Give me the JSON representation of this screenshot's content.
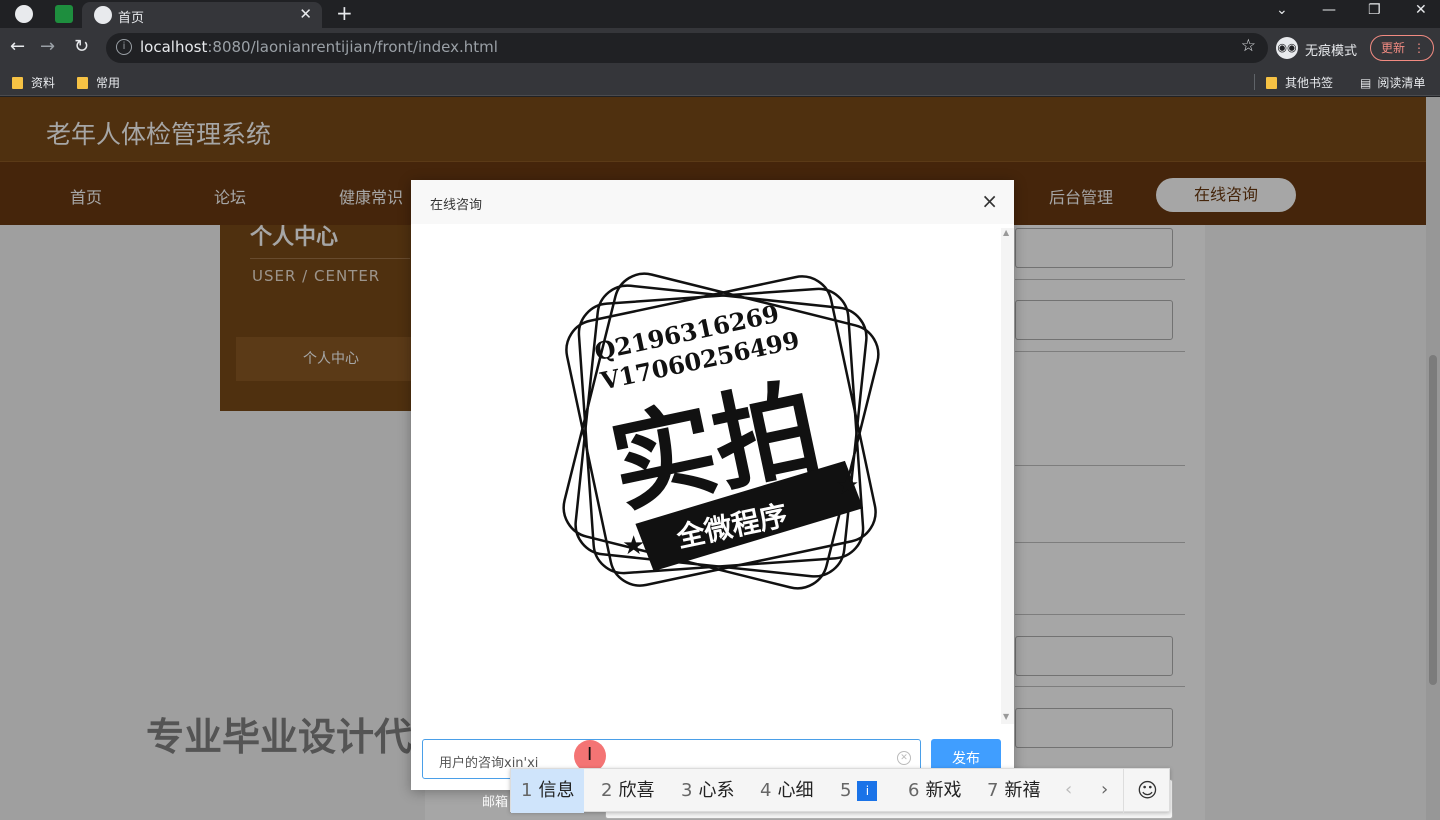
{
  "browser": {
    "tab_title": "首页",
    "url_host": "localhost",
    "url_rest": ":8080/laonianrentijian/front/index.html",
    "incognito_label": "无痕模式",
    "update_label": "更新",
    "bookmarks": [
      "资料",
      "常用"
    ],
    "bookmarks_right": [
      "其他书签",
      "阅读清单"
    ]
  },
  "site": {
    "title": "老年人体检管理系统",
    "nav": [
      "首页",
      "论坛",
      "健康常识",
      "后台管理"
    ],
    "nav_active": "在线咨询"
  },
  "sidebar": {
    "title": "个人中心",
    "subtitle": "USER / CENTER",
    "button": "个人中心"
  },
  "form": {
    "email_label": "邮箱"
  },
  "watermark": "专业毕业设计代做",
  "modal": {
    "title": "在线咨询",
    "close": "×",
    "stamp_lines": [
      "Q2196316269",
      "V17060256499"
    ],
    "stamp_big": "实拍",
    "stamp_ribbon": "全微程序",
    "input_value": "用户的咨询xin'xi",
    "publish_label": "发布"
  },
  "ime": {
    "candidates": [
      {
        "num": "1",
        "text": "信息"
      },
      {
        "num": "2",
        "text": "欣喜"
      },
      {
        "num": "3",
        "text": "心系"
      },
      {
        "num": "4",
        "text": "心细"
      },
      {
        "num": "5",
        "text": "i"
      },
      {
        "num": "6",
        "text": "新戏"
      },
      {
        "num": "7",
        "text": "新禧"
      }
    ]
  }
}
